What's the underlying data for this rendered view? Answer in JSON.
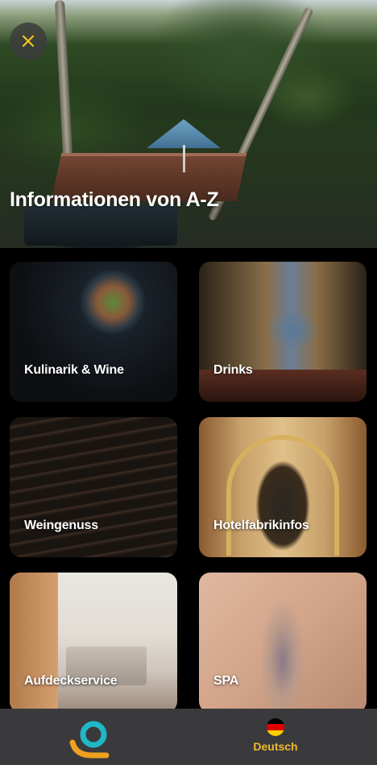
{
  "header": {
    "title": "Informationen von A-Z",
    "close_icon": "close-icon",
    "accent": "#f5c518"
  },
  "categories": [
    {
      "label": "Kulinarik & Wine"
    },
    {
      "label": "Drinks"
    },
    {
      "label": "Weingenuss"
    },
    {
      "label": "Hotelfabrikinfos"
    },
    {
      "label": "Aufdeckservice"
    },
    {
      "label": "SPA"
    }
  ],
  "navbar": {
    "logo_icon": "app-logo-icon",
    "language_label": "Deutsch",
    "flag_icon": "german-flag-icon",
    "label_color": "#f0b830"
  }
}
